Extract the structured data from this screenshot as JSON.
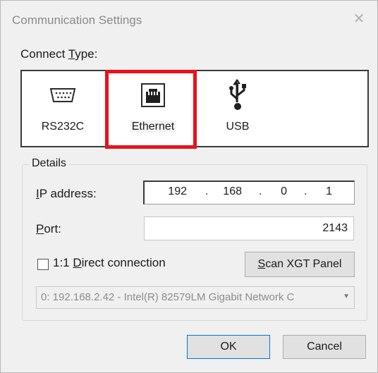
{
  "window": {
    "title": "Communication Settings",
    "close_glyph": "✕"
  },
  "connect_type": {
    "label_pre": "Connect ",
    "label_key": "T",
    "label_post": "ype:",
    "options": [
      {
        "label": "RS232C",
        "icon": "serial-port-icon"
      },
      {
        "label": "Ethernet",
        "icon": "ethernet-port-icon",
        "selected": true
      },
      {
        "label": "USB",
        "icon": "usb-icon"
      }
    ],
    "highlight_color": "#e8121b"
  },
  "details": {
    "legend": "Details",
    "ip_label_key": "I",
    "ip_label_rest": "P address:",
    "ip_octets": [
      "192",
      "168",
      "0",
      "1"
    ],
    "ip_dot": ".",
    "port_label_key": "P",
    "port_label_rest": "ort:",
    "port_value": "2143",
    "direct_label_pre": "1:1 ",
    "direct_label_key": "D",
    "direct_label_post": "irect connection",
    "direct_checked": false,
    "scan_key": "S",
    "scan_rest": "can XGT Panel",
    "adapter_value": "0: 192.168.2.42 - Intel(R) 82579LM Gigabit Network C",
    "adapter_arrow": "▼"
  },
  "buttons": {
    "ok": "OK",
    "cancel": "Cancel"
  }
}
